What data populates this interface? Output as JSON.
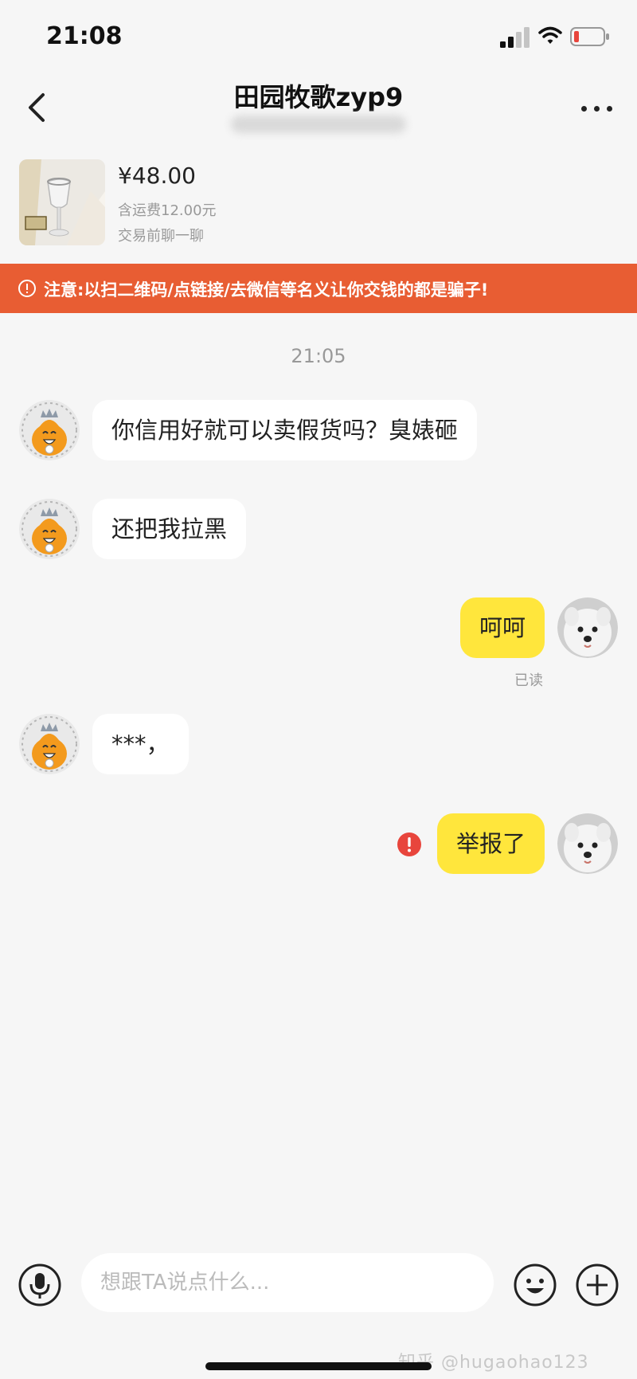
{
  "status_bar": {
    "time": "21:08"
  },
  "header": {
    "title": "田园牧歌zyp9"
  },
  "product": {
    "price": "¥48.00",
    "shipping": "含运费12.00元",
    "hint": "交易前聊一聊"
  },
  "warning": {
    "text": "注意:以扫二维码/点链接/去微信等名义让你交钱的都是骗子!"
  },
  "chat": {
    "time_divider": "21:05",
    "messages": [
      {
        "from": "them",
        "text": "你信用好就可以卖假货吗？臭婊砸"
      },
      {
        "from": "them",
        "text": "还把我拉黑"
      },
      {
        "from": "me",
        "text": "呵呵",
        "status": "已读"
      },
      {
        "from": "them",
        "text": "***，"
      },
      {
        "from": "me",
        "text": "举报了",
        "failed": true
      }
    ]
  },
  "input": {
    "placeholder": "想跟TA说点什么..."
  },
  "watermark": "知乎 @hugaohao123",
  "colors": {
    "background": "#f6f6f6",
    "warning_banner": "#e85d33",
    "outgoing_bubble": "#ffe63c",
    "incoming_bubble": "#ffffff",
    "error_red": "#e8453c"
  },
  "icons": {
    "back": "chevron-left-icon",
    "more": "more-dots-icon",
    "warning": "info-circle-icon",
    "voice": "microphone-icon",
    "emoji": "smiley-icon",
    "plus": "plus-circle-icon",
    "error": "exclamation-circle-icon"
  }
}
